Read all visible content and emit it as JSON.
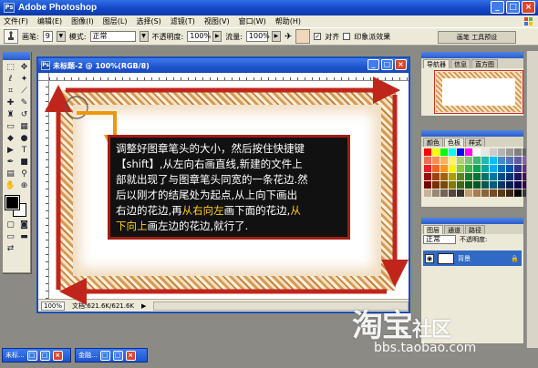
{
  "app": {
    "title": "Adobe Photoshop",
    "badge": "Ps"
  },
  "menu": [
    "文件(F)",
    "编辑(E)",
    "图像(I)",
    "图层(L)",
    "选择(S)",
    "滤镜(T)",
    "视图(V)",
    "窗口(W)",
    "帮助(H)"
  ],
  "options": {
    "brush_label": "画笔:",
    "brush_size": "9",
    "mode_label": "模式:",
    "mode_value": "正常",
    "opacity_label": "不透明度:",
    "opacity_value": "100%",
    "flow_label": "流量:",
    "flow_value": "100%",
    "aligned_label": "对齐",
    "sample_label": "印象派效果",
    "brushes_tab": "画笔 工具预设"
  },
  "document": {
    "title": "未标题-2 @ 100%(RGB/8)",
    "zoom": "100%",
    "doc_size": "文档:621.6K/621.6K"
  },
  "note": {
    "line1": "调整好图章笔头的大小，然后按住快捷键",
    "line2": "【shift】,从左向右画直线,新建的文件上",
    "line3": "部就出现了与图章笔头同宽的一条花边.然",
    "line4": "后以刚才的结尾处为起点,从上向下画出",
    "line5a": "右边的花边,再",
    "line5b": "从右向左",
    "line5c": "画下面的花边,",
    "line5d": "从",
    "line6a": "下向上",
    "line6b": "画左边的花边,就行了."
  },
  "navigator": {
    "tabs": [
      "导航器",
      "信息",
      "直方图"
    ]
  },
  "swatches": {
    "tabs": [
      "颜色",
      "色板",
      "样式"
    ],
    "colors": [
      "#ff0000",
      "#ffff00",
      "#00ff00",
      "#00ffff",
      "#0000ff",
      "#ff00ff",
      "#ffffff",
      "#e6e6e6",
      "#cccccc",
      "#b3b3b3",
      "#999999",
      "#808080",
      "#666666",
      "#f26c4f",
      "#f68e55",
      "#fbaf5c",
      "#fff467",
      "#acd372",
      "#7cc576",
      "#3bb878",
      "#1abbb4",
      "#00bff3",
      "#438ccb",
      "#5574b9",
      "#605ca8",
      "#855fa8",
      "#ed1c24",
      "#f26522",
      "#f7941d",
      "#fff200",
      "#8dc63f",
      "#39b54a",
      "#00a651",
      "#00a99d",
      "#00aeef",
      "#0072bc",
      "#0054a6",
      "#2e3192",
      "#662d91",
      "#9e0b0f",
      "#a0410d",
      "#a36209",
      "#aba000",
      "#598527",
      "#1a7b30",
      "#007236",
      "#00746b",
      "#0076a3",
      "#004b80",
      "#003471",
      "#1b1464",
      "#440e62",
      "#790000",
      "#7b2e00",
      "#7d4900",
      "#827b00",
      "#406618",
      "#005e20",
      "#005826",
      "#005952",
      "#005b7f",
      "#003663",
      "#002157",
      "#0d004c",
      "#32004b",
      "#c7b299",
      "#998675",
      "#736357",
      "#534741",
      "#37302d",
      "#c69c6d",
      "#a67c52",
      "#8c6239",
      "#754c24",
      "#603913",
      "#3c2415",
      "#000000",
      "#363636"
    ]
  },
  "layers": {
    "tabs": [
      "图层",
      "通道",
      "路径"
    ],
    "blend_mode": "正常",
    "opacity_label": "不透明度:",
    "layer_name": "背景"
  },
  "taskbar": {
    "item1": "未标...",
    "item2": "金融..."
  },
  "watermark": {
    "brand_a": "淘宝",
    "brand_b": "社区",
    "url": "bbs.taobao.com"
  },
  "colors": {
    "arrow_red": "#c0251b",
    "arrow_orange": "#f0960c",
    "highlight": "#ffd21a"
  }
}
